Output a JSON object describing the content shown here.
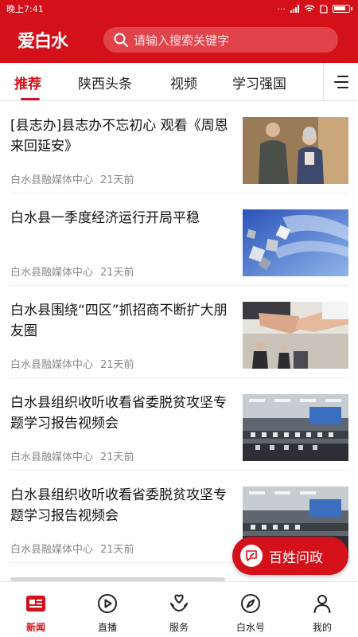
{
  "status_bar": {
    "time": "晚上7:41",
    "battery_level": 0.8
  },
  "header": {
    "logo": "爱白水",
    "search_placeholder": "请输入搜索关键字",
    "brand_color": "#d4101b"
  },
  "tabs": [
    {
      "label": "推荐",
      "active": true
    },
    {
      "label": "陕西头条",
      "active": false
    },
    {
      "label": "视频",
      "active": false
    },
    {
      "label": "学习强国",
      "active": false
    }
  ],
  "articles": [
    {
      "title": "[县志办]县志办不忘初心 观看《周恩来回延安》",
      "source": "白水县融媒体中心",
      "time": "21天前",
      "thumbnail": "elderly-couple-photo"
    },
    {
      "title": "白水县一季度经济运行开局平稳",
      "source": "白水县融媒体中心",
      "time": "21天前",
      "thumbnail": "blue-cubes-graphic"
    },
    {
      "title": "白水县围绕“四区”抓招商不断扩大朋友圈",
      "source": "白水县融媒体中心",
      "time": "21天前",
      "thumbnail": "handshake-photo"
    },
    {
      "title": "白水县组织收听收看省委脱贫攻坚专题学习报告视频会",
      "source": "白水县融媒体中心",
      "time": "21天前",
      "thumbnail": "conference-hall-photo"
    },
    {
      "title": "白水县组织收听收看省委脱贫攻坚专题学习报告视频会",
      "source": "白水县融媒体中心",
      "time": "21天前",
      "thumbnail": "conference-hall-photo"
    }
  ],
  "floating_button": {
    "label": "百姓问政",
    "icon": "edit-bubble-icon"
  },
  "bottom_nav": [
    {
      "label": "新闻",
      "icon": "news-icon",
      "active": true
    },
    {
      "label": "直播",
      "icon": "play-icon",
      "active": false
    },
    {
      "label": "服务",
      "icon": "heart-hands-icon",
      "active": false
    },
    {
      "label": "白水号",
      "icon": "compass-icon",
      "active": false
    },
    {
      "label": "我的",
      "icon": "person-icon",
      "active": false
    }
  ]
}
